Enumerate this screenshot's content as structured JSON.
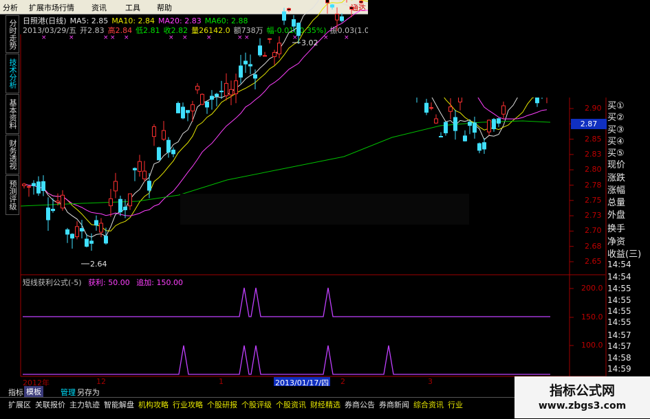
{
  "menu": {
    "items": [
      "分析",
      "扩展市场行情",
      "资讯",
      "工具",
      "帮助"
    ],
    "right_text": "通达"
  },
  "left_tabs": [
    {
      "label": "分时走势",
      "active": false
    },
    {
      "label": "技术分析",
      "active": true
    },
    {
      "label": "基本资料",
      "active": false
    },
    {
      "label": "财务透视",
      "active": false
    },
    {
      "label": "预测评级",
      "active": false
    }
  ],
  "header": {
    "line1": [
      {
        "text": "日照港(日线)",
        "color": "#e0e0e0"
      },
      {
        "text": "MA5: 2.85",
        "color": "#e0e0e0"
      },
      {
        "text": "MA10: 2.84",
        "color": "#e6e600"
      },
      {
        "text": "MA20: 2.83",
        "color": "#ff40ff"
      },
      {
        "text": "MA60: 2.88",
        "color": "#00e000"
      }
    ],
    "line2": [
      {
        "text": "2013/03/29/五",
        "color": "#c0c0c0"
      },
      {
        "text": "开2.83",
        "color": "#c0c0c0"
      },
      {
        "text": "高2.84",
        "color": "#ff4040"
      },
      {
        "text": "低2.81",
        "color": "#00e000"
      },
      {
        "text": "收2.82",
        "color": "#00e000"
      },
      {
        "text": "量26142.0",
        "color": "#e6e600"
      },
      {
        "text": "额738万",
        "color": "#c0c0c0"
      },
      {
        "text": "幅-0.01(-0.35%)",
        "color": "#00e000"
      },
      {
        "text": "振0.03(1.06%)",
        "color": "#c0c0c0"
      }
    ]
  },
  "price_chart": {
    "high_marker": "3.02",
    "low_marker": "2.64",
    "y_ticks": [
      "2.90",
      "2.88",
      "2.85",
      "2.83",
      "2.80",
      "2.78",
      "2.75",
      "2.73",
      "2.70",
      "2.68",
      "2.65"
    ],
    "current_price_label": "2.87"
  },
  "indicator": {
    "title": "短线获利公式(-5)",
    "param1": "获利: 50.00",
    "param2": "追加: 150.00",
    "y_ticks": [
      "200.0",
      "150.0",
      "100.0"
    ]
  },
  "right_panel": {
    "labels": [
      "买①",
      "买②",
      "买③",
      "买④",
      "买⑤",
      "现价",
      "涨跌",
      "涨幅",
      "总量",
      "外盘",
      "换手",
      "净资",
      "收益(三)"
    ],
    "times": [
      "14:54",
      "14:54",
      "14:55",
      "14:55",
      "14:55",
      "14:55",
      "14:57",
      "14:57",
      "14:58",
      "14:59"
    ]
  },
  "timeline": {
    "labels": [
      "2012年",
      "12",
      "1",
      "2013/01/17/四",
      "2",
      "3"
    ]
  },
  "bottom_tabs": [
    "指标",
    "模板",
    "管理",
    "另存为"
  ],
  "bottom_bar": [
    "扩展区",
    "关联报价",
    "主力轨迹",
    "智能解盘",
    "机构攻略",
    "行业攻略",
    "个股研报",
    "个股评级",
    "个股资讯",
    "财经精选",
    "券商公告",
    "券商新闻",
    "综合资讯",
    "行业"
  ],
  "watermark": {
    "title": "指标公式网",
    "url": "www.zbgs3.com"
  }
}
